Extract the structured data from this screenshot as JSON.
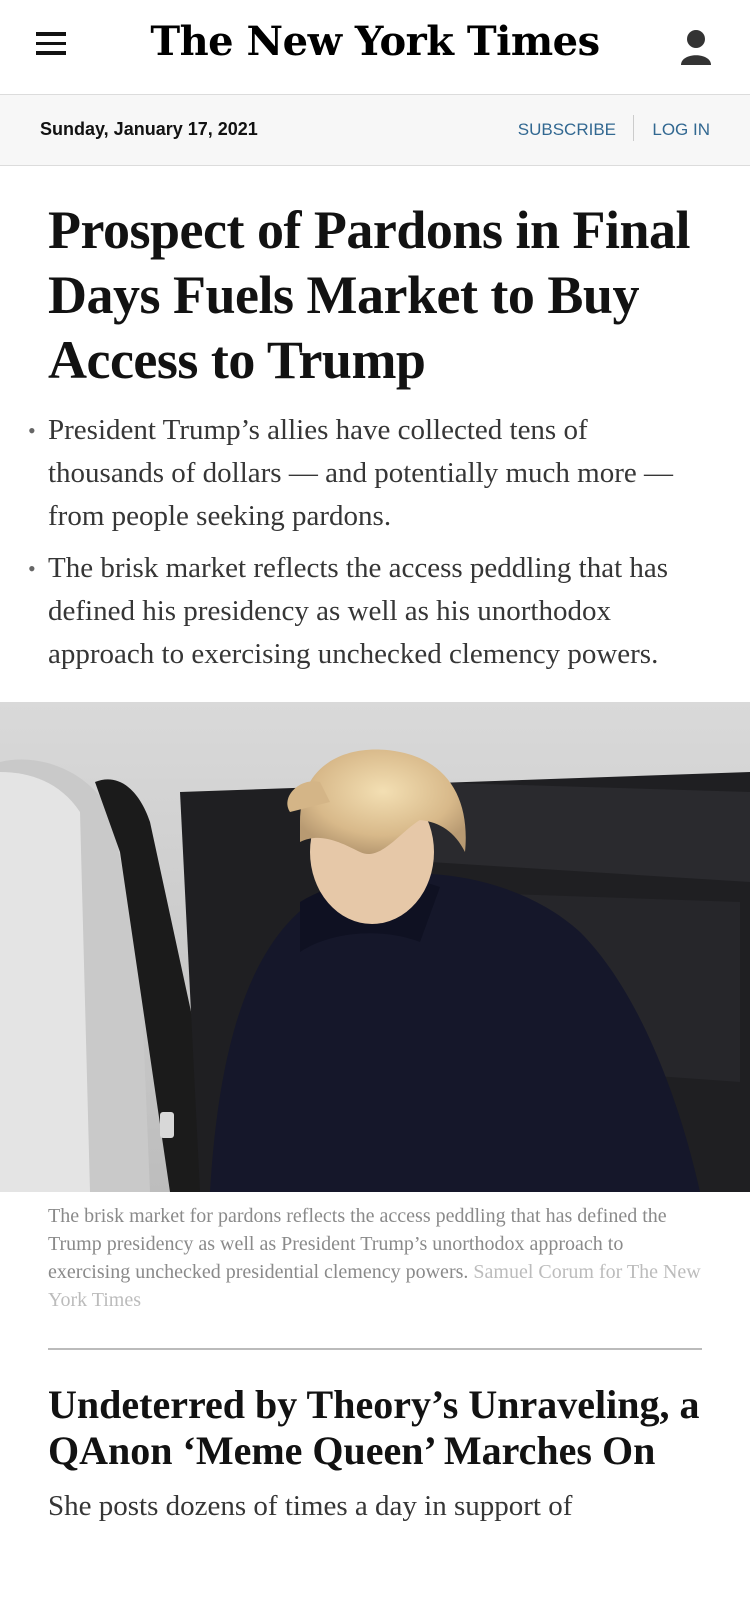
{
  "header": {
    "masthead": "The New York Times",
    "menu_icon": "hamburger-menu-icon",
    "user_icon": "user-account-icon"
  },
  "datebar": {
    "date": "Sunday, January 17, 2021",
    "subscribe": "SUBSCRIBE",
    "login": "LOG IN"
  },
  "lead_story": {
    "headline": "Prospect of Pardons in Final Days Fuels Market to Buy Access to Trump",
    "bullets": [
      "President Trump’s allies have collected tens of thousands of dollars — and potentially much more — from people seeking pardons.",
      "The brisk market reflects the access peddling that has defined his presidency as well as his unorthodox approach to exercising unchecked clemency powers."
    ],
    "caption": "The brisk market for pardons reflects the access peddling that has defined the Trump presidency as well as President Trump’s unorthodox approach to exercising unchecked presidential clemency powers.",
    "credit": "Samuel Corum for The New York Times"
  },
  "second_story": {
    "headline": "Undeterred by Theory’s Unraveling, a QAnon ‘Meme Queen’ Marches On",
    "summary": "She posts dozens of times a day in support of"
  },
  "colors": {
    "link": "#326891",
    "text": "#121212",
    "caption": "#8a8a8a"
  }
}
